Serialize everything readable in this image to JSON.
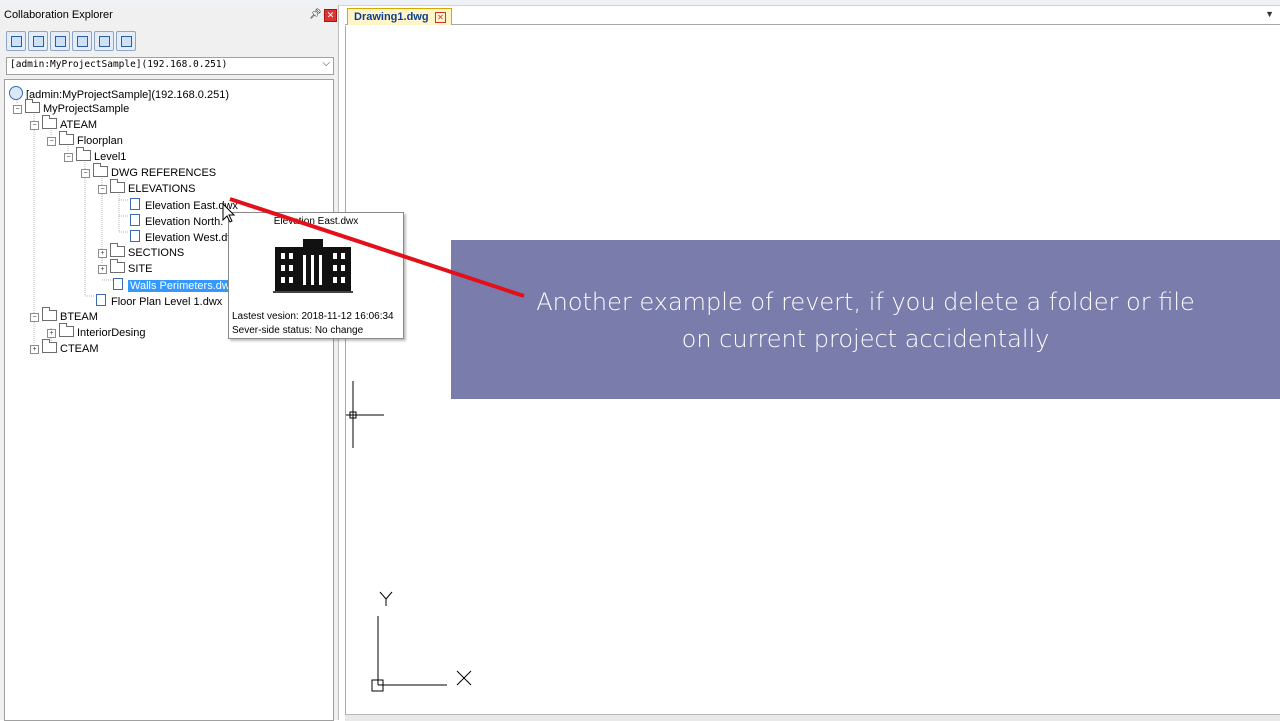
{
  "panel": {
    "title": "Collaboration Explorer",
    "pin_icon": "pin-icon",
    "close_icon": "close-icon",
    "toolbar_icons": [
      "connect-icon",
      "project-list-icon",
      "sync-icon",
      "preview-icon",
      "upload-icon",
      "download-icon"
    ],
    "server_combo": {
      "value": "[admin:MyProjectSample](192.168.0.251)"
    }
  },
  "tree": {
    "root": "[admin:MyProjectSample](192.168.0.251)",
    "project": "MyProjectSample",
    "ateam": "ATEAM",
    "floorplan": "Floorplan",
    "level1": "Level1",
    "dwg_references": "DWG REFERENCES",
    "elevations": "ELEVATIONS",
    "elevation_east": "Elevation East.dwx",
    "elevation_north": "Elevation North.",
    "elevation_west": "Elevation West.dv",
    "sections": "SECTIONS",
    "site": "SITE",
    "walls_perimeters": "Walls Perimeters.dwx",
    "floor_plan_level1": "Floor Plan Level 1.dwx",
    "bteam": "BTEAM",
    "interior": "InteriorDesing",
    "cteam": "CTEAM"
  },
  "tooltip": {
    "title": "Elevation East.dwx",
    "version": "Lastest vesion: 2018-11-12 16:06:34",
    "status": "Sever-side status: No change"
  },
  "document": {
    "tab_label": "Drawing1.dwg"
  },
  "axis": {
    "y_label": "Y",
    "x_label": "X"
  },
  "banner": {
    "line1": "Another example of revert, if you delete a folder or file",
    "line2": "on current project accidentally"
  },
  "colors": {
    "banner": "#7a7cac",
    "selection": "#3399ff",
    "arrow": "#e3101a"
  }
}
